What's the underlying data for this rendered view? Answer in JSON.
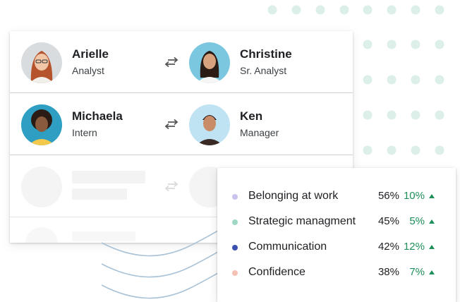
{
  "pairs": [
    {
      "left": {
        "name": "Arielle",
        "role": "Analyst"
      },
      "right": {
        "name": "Christine",
        "role": "Sr. Analyst"
      }
    },
    {
      "left": {
        "name": "Michaela",
        "role": "Intern"
      },
      "right": {
        "name": "Ken",
        "role": "Manager"
      }
    }
  ],
  "metrics": [
    {
      "label": "Belonging at work",
      "percent": "56%",
      "change": "10%",
      "dot_color": "#c9c3ee"
    },
    {
      "label": "Strategic managment",
      "percent": "45%",
      "change": "5%",
      "dot_color": "#9fd8c4"
    },
    {
      "label": "Communication",
      "percent": "42%",
      "change": "12%",
      "dot_color": "#3c4fb3"
    },
    {
      "label": "Confidence",
      "percent": "38%",
      "change": "7%",
      "dot_color": "#f4c2b4"
    }
  ],
  "colors": {
    "positive": "#1e8e5a",
    "dot_pattern": "#dcefe9",
    "wave": "#a9c2d6"
  },
  "icons": {
    "swap": "swap-arrows-icon",
    "trend": "triangle-up-icon"
  }
}
